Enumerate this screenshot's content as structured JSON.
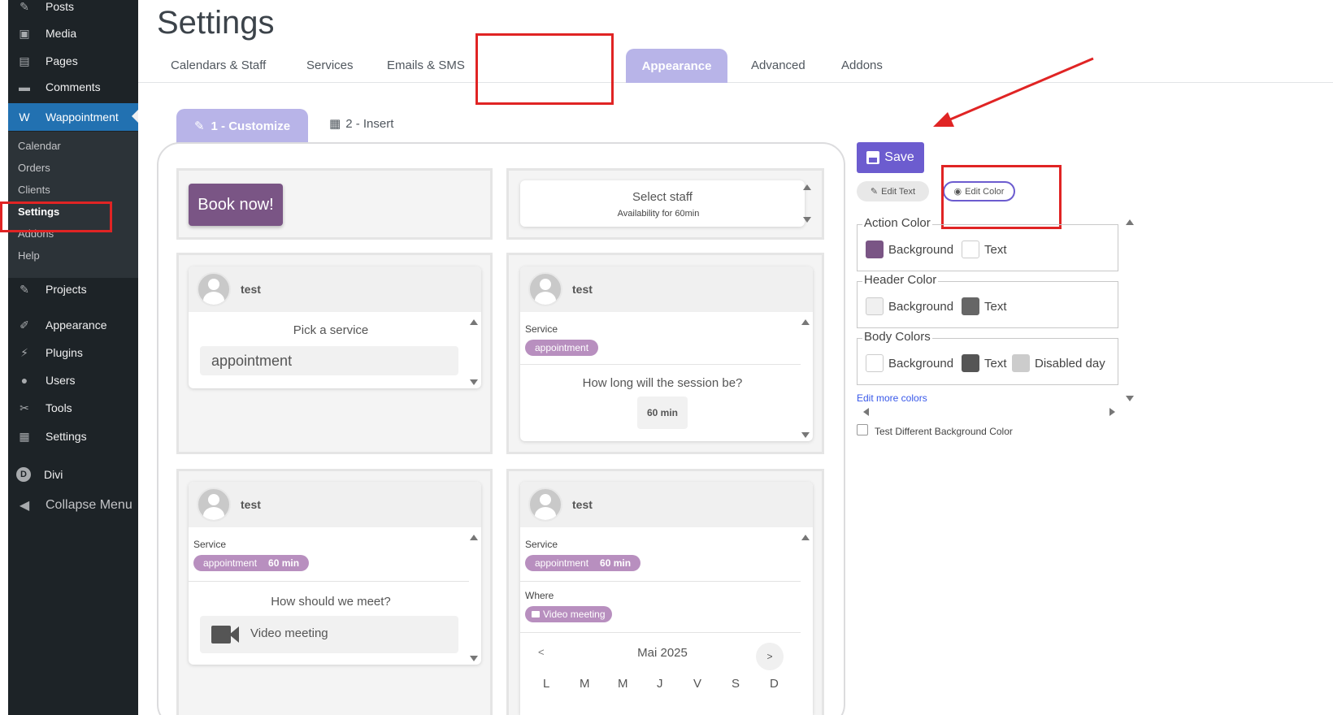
{
  "sidebar": {
    "items": [
      {
        "label": "Posts",
        "icon": "pin-icon"
      },
      {
        "label": "Media",
        "icon": "media-icon"
      },
      {
        "label": "Pages",
        "icon": "pages-icon"
      },
      {
        "label": "Comments",
        "icon": "comments-icon"
      },
      {
        "label": "Wappointment",
        "icon": "wappointment-icon"
      },
      {
        "label": "Projects",
        "icon": "pin-icon"
      },
      {
        "label": "Appearance",
        "icon": "brush-icon"
      },
      {
        "label": "Plugins",
        "icon": "plugin-icon"
      },
      {
        "label": "Users",
        "icon": "user-icon"
      },
      {
        "label": "Tools",
        "icon": "wrench-icon"
      },
      {
        "label": "Settings",
        "icon": "settings-icon"
      },
      {
        "label": "Divi",
        "icon": "divi-icon"
      },
      {
        "label": "Collapse Menu",
        "icon": "collapse-icon"
      }
    ],
    "submenu": [
      "Calendar",
      "Orders",
      "Clients",
      "Settings",
      "Addons",
      "Help"
    ]
  },
  "header": {
    "title": "Settings",
    "tabs": [
      "Calendars & Staff",
      "Services",
      "Emails & SMS",
      "Appearance",
      "Advanced",
      "Addons"
    ]
  },
  "subtabs": {
    "customize": "1 - Customize",
    "insert": "2 - Insert"
  },
  "preview": {
    "book_now": "Book now!",
    "select_staff": "Select staff",
    "availability": "Availability for 60min",
    "staff_name": "test",
    "pick_service": "Pick a service",
    "service_value": "appointment",
    "service_label": "Service",
    "service_pill": "appointment",
    "duration": "60 min",
    "session_question": "How long will the session be?",
    "meet_question": "How should we meet?",
    "video_meeting": "Video meeting",
    "where_label": "Where",
    "month": "Mai 2025",
    "prev": "<",
    "next": ">",
    "weekdays": [
      "L",
      "M",
      "M",
      "J",
      "V",
      "S",
      "D"
    ]
  },
  "editor": {
    "save": "Save",
    "edit_text": "Edit Text",
    "edit_color": "Edit Color",
    "action_color": {
      "legend": "Action Color",
      "background": "Background",
      "text": "Text",
      "bg_color": "#7a5585",
      "text_color": "#ffffff"
    },
    "header_color": {
      "legend": "Header Color",
      "background": "Background",
      "text": "Text",
      "bg_color": "#f0f0f0",
      "text_color": "#666666"
    },
    "body_colors": {
      "legend": "Body Colors",
      "background": "Background",
      "text": "Text",
      "disabled": "Disabled day",
      "bg_color": "#ffffff",
      "text_color": "#555555",
      "disabled_color": "#cccccc"
    },
    "edit_more": "Edit more colors",
    "test_bg": "Test Different Background Color"
  }
}
